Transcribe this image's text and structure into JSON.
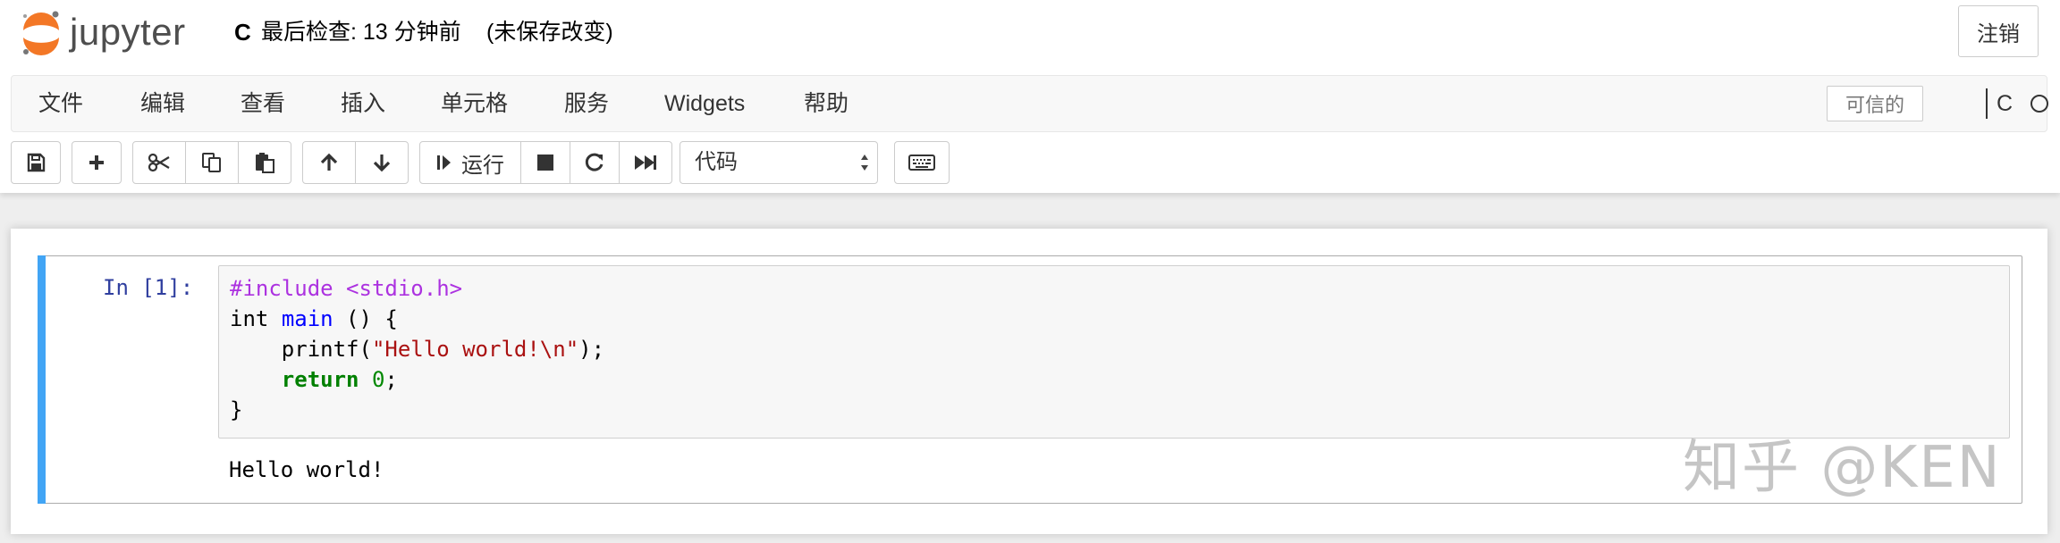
{
  "header": {
    "logo_text": "jupyter",
    "notebook_title": "C",
    "checkpoint": "最后检查: 13 分钟前",
    "autosave_status": "(未保存改变)",
    "logout_label": "注销"
  },
  "menubar": {
    "items": [
      "文件",
      "编辑",
      "查看",
      "插入",
      "单元格",
      "服务",
      "Widgets",
      "帮助"
    ],
    "trusted_label": "可信的",
    "kernel_name": "C"
  },
  "toolbar": {
    "run_label": "运行",
    "cell_type": "代码",
    "buttons": [
      "save-icon",
      "plus-icon",
      "cut-icon",
      "copy-icon",
      "paste-icon",
      "arrow-up-icon",
      "arrow-down-icon",
      "run-icon",
      "stop-icon",
      "restart-icon",
      "fast-forward-icon",
      "keyboard-icon"
    ]
  },
  "cell": {
    "prompt": "In [1]:",
    "code": {
      "line1": "#include <stdio.h>",
      "line2_type": "int",
      "line2_fn": "main",
      "line2_rest": " () {",
      "line3_indent": "    ",
      "line3_call": "printf(",
      "line3_str": "\"Hello world!\\n\"",
      "line3_end": ");",
      "line4_indent": "    ",
      "line4_kw": "return",
      "line4_num": "0",
      "line4_end": ";",
      "line5": "}"
    },
    "output": "Hello world!"
  },
  "watermark": "知乎 @KEN",
  "colors": {
    "accent": "#42a5f5",
    "prompt": "#303f9f",
    "logo_orange": "#f37726"
  }
}
